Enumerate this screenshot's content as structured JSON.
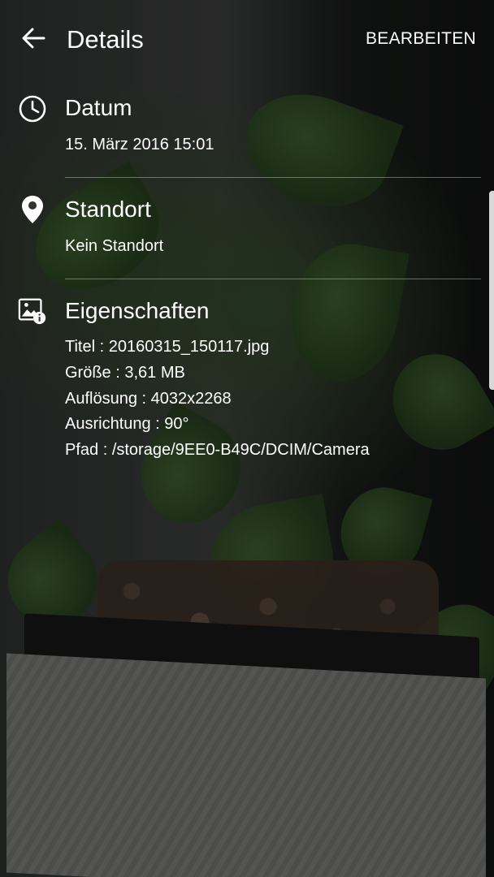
{
  "header": {
    "title": "Details",
    "edit_label": "BEARBEITEN"
  },
  "date": {
    "title": "Datum",
    "value": "15. März 2016 15:01"
  },
  "location": {
    "title": "Standort",
    "value": "Kein Standort"
  },
  "properties": {
    "title": "Eigenschaften",
    "lines": [
      "Titel : 20160315_150117.jpg",
      "Größe : 3,61 MB",
      "Auflösung : 4032x2268",
      "Ausrichtung : 90°",
      "Pfad : /storage/9EE0-B49C/DCIM/Camera"
    ]
  },
  "icons": {
    "back": "arrow-left-icon",
    "date": "clock-icon",
    "location": "location-pin-icon",
    "properties": "image-info-icon"
  },
  "colors": {
    "text": "#ffffff",
    "divider": "rgba(255,255,255,0.35)",
    "overlay": "rgba(0,0,0,0.45)"
  }
}
